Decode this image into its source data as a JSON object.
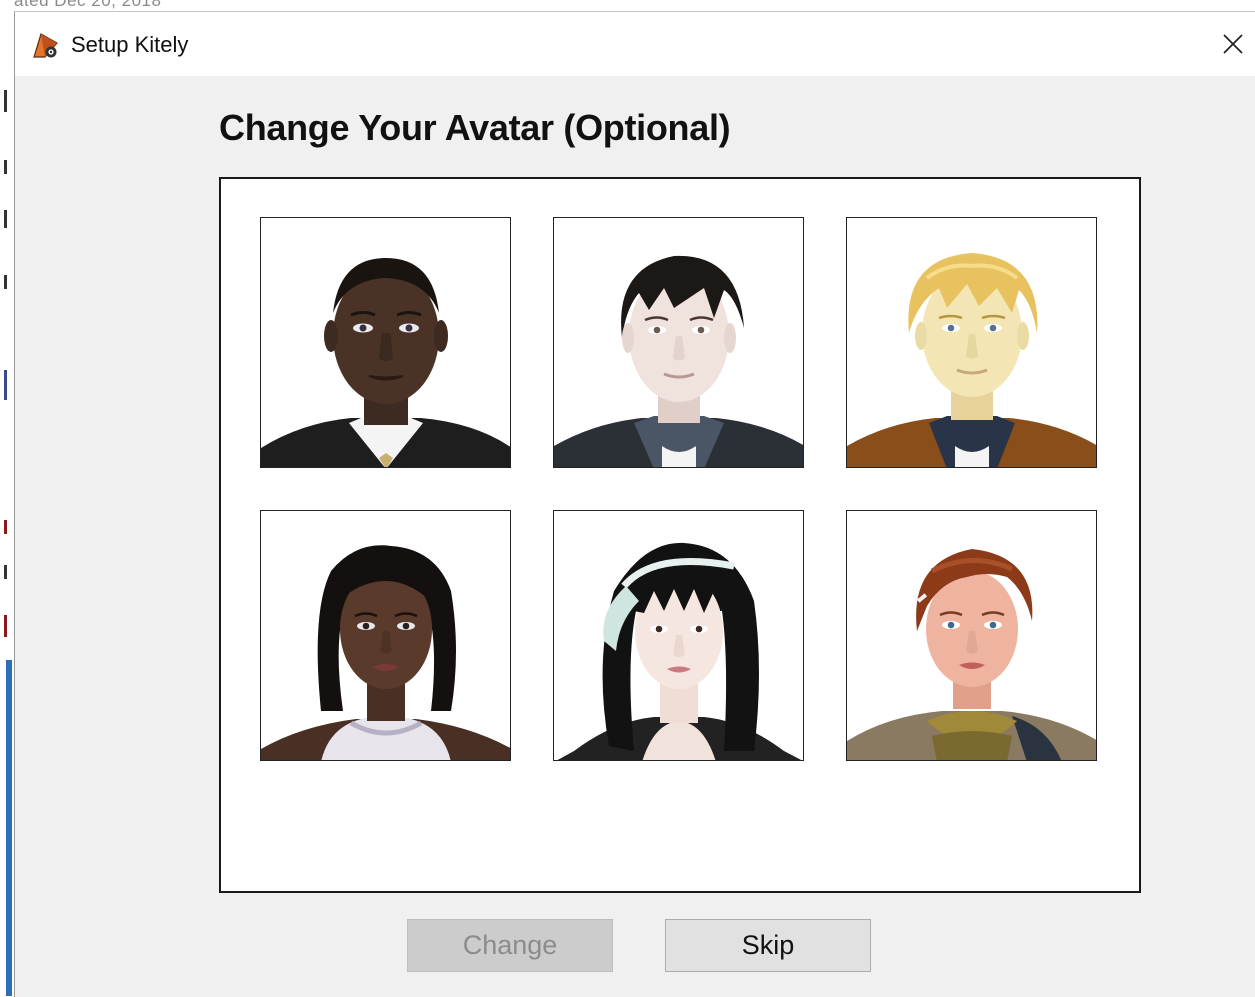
{
  "window": {
    "title": "Setup Kitely",
    "background_fragment": "ated Dec 20, 2018"
  },
  "dialog": {
    "heading": "Change Your Avatar (Optional)"
  },
  "avatars": [
    {
      "name": "male-dark-skin-suit"
    },
    {
      "name": "male-dark-hair"
    },
    {
      "name": "male-blond-hair"
    },
    {
      "name": "female-dark-skin"
    },
    {
      "name": "female-black-hair-headband"
    },
    {
      "name": "female-auburn-hair"
    }
  ],
  "buttons": {
    "change_label": "Change",
    "change_enabled": false,
    "skip_label": "Skip"
  },
  "colors": {
    "window_bg": "#f0f0f0",
    "titlebar_bg": "#ffffff",
    "panel_bg": "#ffffff",
    "disabled_button": "#cccccc",
    "button": "#e1e1e1"
  }
}
